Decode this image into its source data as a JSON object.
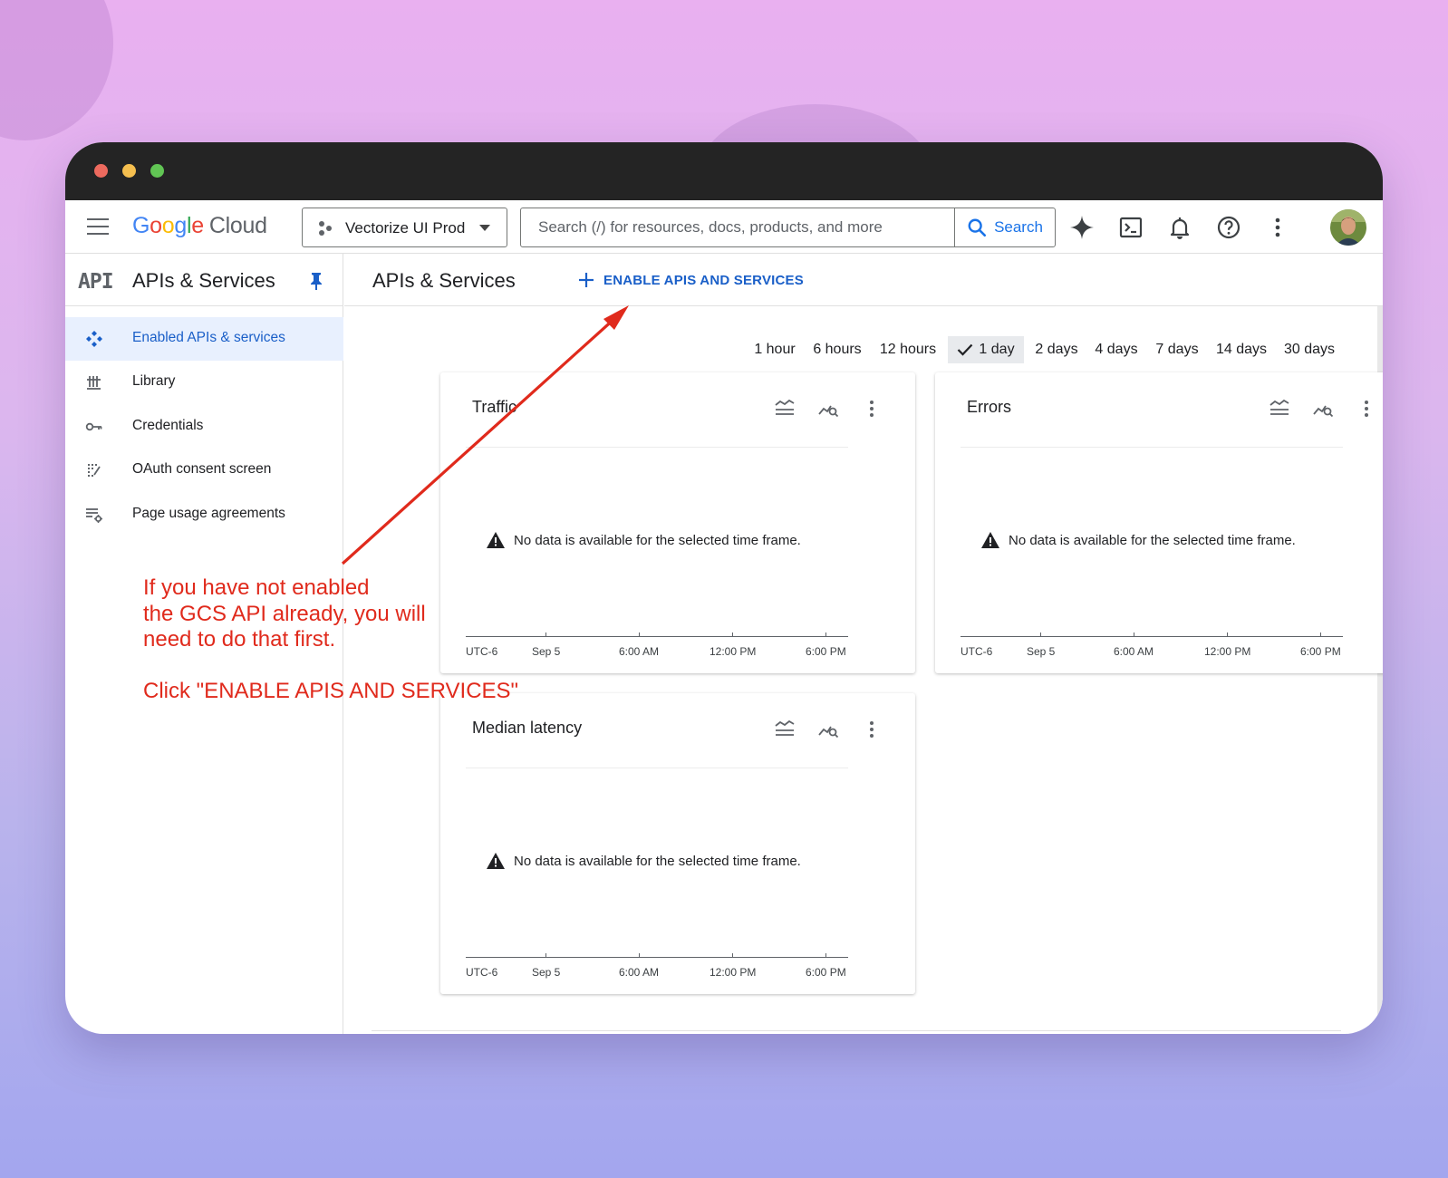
{
  "topbar": {
    "logo_letters": [
      "G",
      "o",
      "o",
      "g",
      "l",
      "e"
    ],
    "logo_product": "Cloud",
    "project_name": "Vectorize UI Prod",
    "search_placeholder": "Search (/) for resources, docs, products, and more",
    "search_button": "Search",
    "icons": [
      "gemini-sparkle-icon",
      "cloud-shell-icon",
      "notifications-bell-icon",
      "help-icon",
      "more-vert-icon"
    ]
  },
  "sidebar": {
    "badge": "API",
    "title": "APIs & Services",
    "items": [
      {
        "label": "Enabled APIs & services",
        "icon": "enabled-apis-icon",
        "active": true
      },
      {
        "label": "Library",
        "icon": "library-icon",
        "active": false
      },
      {
        "label": "Credentials",
        "icon": "key-icon",
        "active": false
      },
      {
        "label": "OAuth consent screen",
        "icon": "oauth-icon",
        "active": false
      },
      {
        "label": "Page usage agreements",
        "icon": "settings-list-icon",
        "active": false
      }
    ]
  },
  "main": {
    "title": "APIs & Services",
    "enable_button": "ENABLE APIS AND SERVICES",
    "time_ranges": [
      {
        "label": "1 hour",
        "selected": false
      },
      {
        "label": "6 hours",
        "selected": false
      },
      {
        "label": "12 hours",
        "selected": false
      },
      {
        "label": "1 day",
        "selected": true
      },
      {
        "label": "2 days",
        "selected": false
      },
      {
        "label": "4 days",
        "selected": false
      },
      {
        "label": "7 days",
        "selected": false
      },
      {
        "label": "14 days",
        "selected": false
      },
      {
        "label": "30 days",
        "selected": false
      }
    ],
    "cards": [
      {
        "title": "Traffic",
        "message": "No data is available for the selected time frame."
      },
      {
        "title": "Errors",
        "message": "No data is available for the selected time frame."
      },
      {
        "title": "Median latency",
        "message": "No data is available for the selected time frame."
      }
    ],
    "axis_labels": [
      "UTC-6",
      "Sep 5",
      "6:00 AM",
      "12:00 PM",
      "6:00 PM"
    ]
  },
  "annotation": {
    "line1": "If you have not enabled",
    "line2": "the GCS API already, you will",
    "line3": "need to do that first.",
    "line4": "Click \"ENABLE APIS AND SERVICES\"",
    "color": "#e02a1c"
  }
}
